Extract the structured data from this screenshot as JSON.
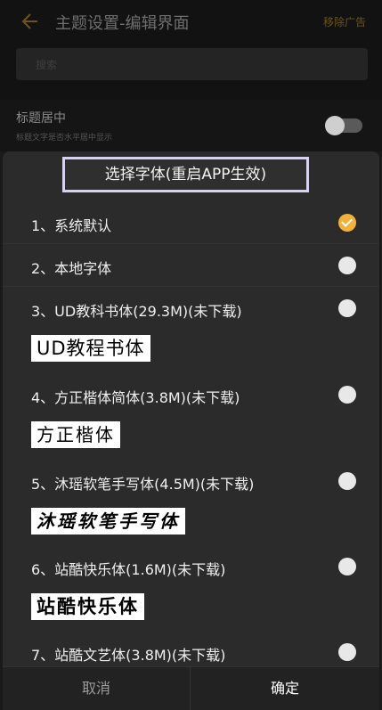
{
  "header": {
    "title": "主题设置-编辑界面",
    "remove_ad": "移除广告",
    "back_icon": "arrow-left-icon"
  },
  "search": {
    "placeholder": "搜索"
  },
  "setting": {
    "title": "标题居中",
    "description": "标题文字是否水平居中显示",
    "enabled": false
  },
  "dialog": {
    "title": "选择字体(重启APP生效)",
    "options": [
      {
        "label": "1、系统默认",
        "selected": true
      },
      {
        "label": "2、本地字体",
        "selected": false
      },
      {
        "label": "3、UD教科书体(29.3M)(未下载)",
        "selected": false,
        "sample": "UD教程书体"
      },
      {
        "label": "4、方正楷体简体(3.8M)(未下载)",
        "selected": false,
        "sample": "方正楷体"
      },
      {
        "label": "5、沐瑶软笔手写体(4.5M)(未下载)",
        "selected": false,
        "sample": "沐瑶软笔手写体"
      },
      {
        "label": "6、站酷快乐体(1.6M)(未下载)",
        "selected": false,
        "sample": "站酷快乐体"
      },
      {
        "label": "7、站酷文艺体(3.8M)(未下载)",
        "selected": false
      }
    ],
    "cancel_label": "取消",
    "confirm_label": "确定"
  },
  "colors": {
    "accent": "#f2b23a",
    "dialog_bg": "#2b2b2b",
    "title_border": "#d8d2ee"
  }
}
